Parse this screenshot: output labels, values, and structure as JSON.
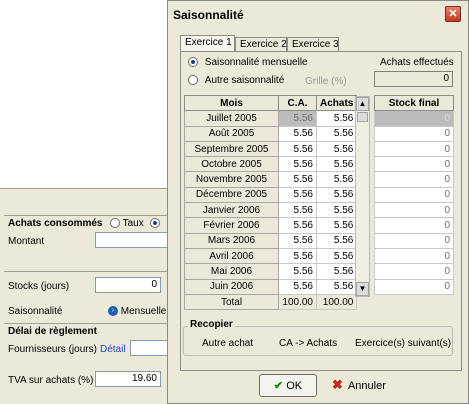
{
  "background_form": {
    "achats_label": "Achats consommés",
    "taux_label": "Taux",
    "montant_label": "Montant",
    "stocks_label": "Stocks (jours)",
    "stocks_value": "0",
    "saisonnalite_label": "Saisonnalité",
    "mensuelle_label": "Mensuelle",
    "delai_label": "Délai de règlement",
    "fournisseurs_label": "Fournisseurs (jours)",
    "detail_label": "Détail",
    "tva_label": "TVA sur achats (%)",
    "tva_value": "19.60"
  },
  "dialog": {
    "title": "Saisonnalité",
    "close_glyph": "✕",
    "tabs": [
      "Exercice 1",
      "Exercice 2",
      "Exercice 3"
    ],
    "radio_mensuelle": "Saisonnalité mensuelle",
    "radio_autre": "Autre saisonnalité",
    "grille_label": "Grille (%)",
    "achats_effectues_label": "Achats effectués",
    "achats_effectues_value": "0",
    "columns": {
      "mois": "Mois",
      "ca": "C.A.",
      "achats": "Achats",
      "stock": "Stock final"
    },
    "rows": [
      {
        "mois": "Juillet 2005",
        "ca": "5.56",
        "achats": "5.56",
        "stock": "0"
      },
      {
        "mois": "Août 2005",
        "ca": "5.56",
        "achats": "5.56",
        "stock": "0"
      },
      {
        "mois": "Septembre 2005",
        "ca": "5.56",
        "achats": "5.56",
        "stock": "0"
      },
      {
        "mois": "Octobre 2005",
        "ca": "5.56",
        "achats": "5.56",
        "stock": "0"
      },
      {
        "mois": "Novembre 2005",
        "ca": "5.56",
        "achats": "5.56",
        "stock": "0"
      },
      {
        "mois": "Décembre 2005",
        "ca": "5.56",
        "achats": "5.56",
        "stock": "0"
      },
      {
        "mois": "Janvier 2006",
        "ca": "5.56",
        "achats": "5.56",
        "stock": "0"
      },
      {
        "mois": "Février 2006",
        "ca": "5.56",
        "achats": "5.56",
        "stock": "0"
      },
      {
        "mois": "Mars 2006",
        "ca": "5.56",
        "achats": "5.56",
        "stock": "0"
      },
      {
        "mois": "Avril 2006",
        "ca": "5.56",
        "achats": "5.56",
        "stock": "0"
      },
      {
        "mois": "Mai 2006",
        "ca": "5.56",
        "achats": "5.56",
        "stock": "0"
      },
      {
        "mois": "Juin 2006",
        "ca": "5.56",
        "achats": "5.56",
        "stock": "0"
      }
    ],
    "total": {
      "label": "Total",
      "ca": "100.00",
      "achats": "100.00"
    },
    "recopier_label": "Recopier",
    "recopier_links": [
      "Autre achat",
      "CA -> Achats",
      "Exercice(s) suivant(s)"
    ],
    "ok_label": "OK",
    "annuler_label": "Annuler"
  }
}
